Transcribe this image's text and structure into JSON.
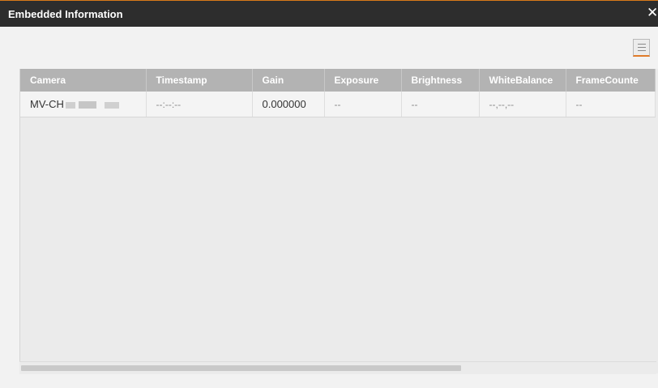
{
  "window": {
    "title": "Embedded Information",
    "close_glyph": "✕"
  },
  "toolbar": {
    "menu_icon": "hamburger-menu-icon"
  },
  "table": {
    "columns": [
      "Camera",
      "Timestamp",
      "Gain",
      "Exposure",
      "Brightness",
      "WhiteBalance",
      "FrameCounte"
    ],
    "rows": [
      {
        "camera": "MV-CH",
        "timestamp": "--:--:--",
        "gain": "0.000000",
        "exposure": "--",
        "brightness": "--",
        "white_balance": "--,--,--",
        "frame_counter": "--"
      }
    ]
  },
  "colors": {
    "title_bar": "#2d2d2d",
    "header_bg": "#b3b3b3",
    "accent": "#e07b2a"
  }
}
